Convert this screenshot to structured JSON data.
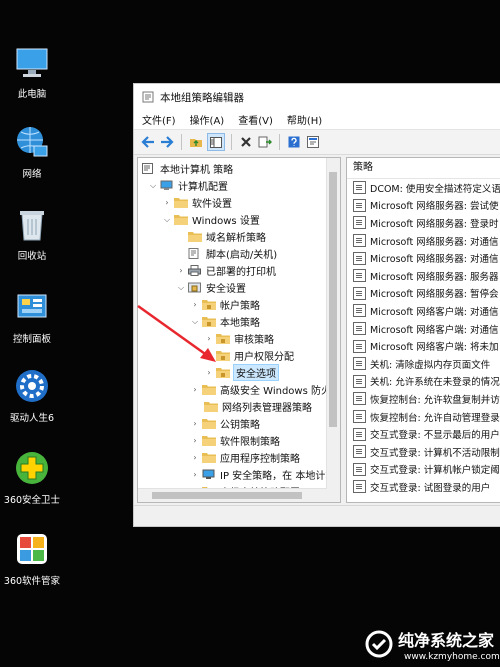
{
  "desktop_icons": [
    {
      "label": "此电脑"
    },
    {
      "label": "网络"
    },
    {
      "label": "回收站"
    },
    {
      "label": "控制面板"
    },
    {
      "label": "驱动人生6"
    },
    {
      "label": "360安全卫士"
    },
    {
      "label": "360软件管家"
    }
  ],
  "window": {
    "title": "本地组策略编辑器",
    "menu": [
      "文件(F)",
      "操作(A)",
      "查看(V)",
      "帮助(H)"
    ]
  },
  "tree": [
    {
      "label": "本地计算机 策略"
    },
    {
      "label": "计算机配置"
    },
    {
      "label": "软件设置"
    },
    {
      "label": "Windows 设置"
    },
    {
      "label": "域名解析策略"
    },
    {
      "label": "脚本(启动/关机)"
    },
    {
      "label": "已部署的打印机"
    },
    {
      "label": "安全设置"
    },
    {
      "label": "帐户策略"
    },
    {
      "label": "本地策略"
    },
    {
      "label": "审核策略"
    },
    {
      "label": "用户权限分配"
    },
    {
      "label": "安全选项"
    },
    {
      "label": "高级安全 Windows 防火"
    },
    {
      "label": "网络列表管理器策略"
    },
    {
      "label": "公钥策略"
    },
    {
      "label": "软件限制策略"
    },
    {
      "label": "应用程序控制策略"
    },
    {
      "label": "IP 安全策略，在 本地计算"
    },
    {
      "label": "高级审核策略配置"
    }
  ],
  "policy_panel": {
    "header": "策略",
    "items": [
      "DCOM: 使用安全描述符定义语",
      "Microsoft 网络服务器: 尝试使",
      "Microsoft 网络服务器: 登录时",
      "Microsoft 网络服务器: 对通信",
      "Microsoft 网络服务器: 对通信",
      "Microsoft 网络服务器: 服务器",
      "Microsoft 网络服务器: 暂停会",
      "Microsoft 网络客户端: 对通信",
      "Microsoft 网络客户端: 对通信",
      "Microsoft 网络客户端: 将未加",
      "关机: 清除虚拟内存页面文件",
      "关机: 允许系统在未登录的情况",
      "恢复控制台: 允许软盘复制并访",
      "恢复控制台: 允许自动管理登录",
      "交互式登录: 不显示最后的用户",
      "交互式登录: 计算机不活动限制",
      "交互式登录: 计算机帐户锁定阈",
      "交互式登录: 试图登录的用户"
    ]
  },
  "watermark": {
    "main": "纯净系统之家",
    "sub": "www.kzmyhome.com"
  }
}
